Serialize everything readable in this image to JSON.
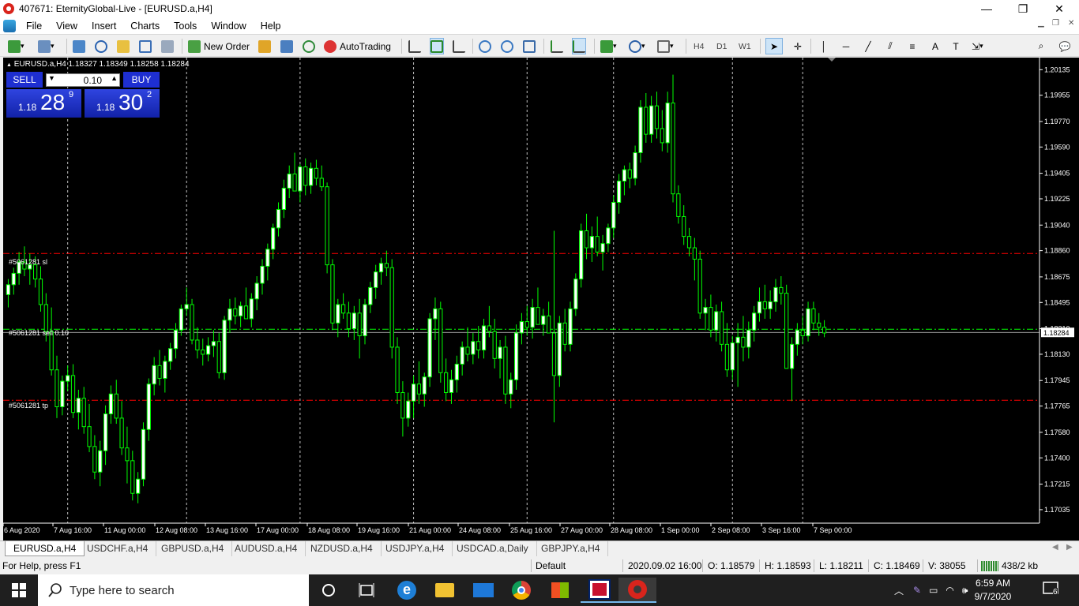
{
  "window": {
    "title": "407671: EternityGlobal-Live - [EURUSD.a,H4]",
    "minimize": "—",
    "restore": "❐",
    "close": "✕"
  },
  "menu": [
    "File",
    "View",
    "Insert",
    "Charts",
    "Tools",
    "Window",
    "Help"
  ],
  "toolbar": {
    "new_order": "New Order",
    "autotrading": "AutoTrading",
    "timeframes": [
      "H4",
      "D1",
      "W1"
    ],
    "text_tool": "A"
  },
  "chart": {
    "header": "EURUSD.a,H4  1.18327 1.18349 1.18258 1.18284",
    "one_click": {
      "sell_label": "SELL",
      "buy_label": "BUY",
      "lot": "0.10",
      "sell_big": "28",
      "sell_prefix": "1.18",
      "sell_sup": "9",
      "buy_big": "30",
      "buy_prefix": "1.18",
      "buy_sup": "2"
    },
    "order_labels": {
      "sl": "#5061281 sl",
      "entry": "#5061281 sell 0.10",
      "tp": "#5061281 tp"
    },
    "levels": {
      "sl": 1.1884,
      "entry": 1.18306,
      "tp": 1.17806,
      "bid": 1.18284
    },
    "current_price_label": "1.18284",
    "price_labels": [
      "1.20135",
      "1.19955",
      "1.19770",
      "1.19590",
      "1.19405",
      "1.19225",
      "1.19040",
      "1.18860",
      "1.18675",
      "1.18495",
      "1.18310",
      "1.18130",
      "1.17945",
      "1.17765",
      "1.17580",
      "1.17400",
      "1.17215",
      "1.17035"
    ],
    "time_labels": [
      "6 Aug 2020",
      "7 Aug 16:00",
      "11 Aug 00:00",
      "12 Aug 08:00",
      "13 Aug 16:00",
      "17 Aug 00:00",
      "18 Aug 08:00",
      "19 Aug 16:00",
      "21 Aug 00:00",
      "24 Aug 08:00",
      "25 Aug 16:00",
      "27 Aug 00:00",
      "28 Aug 08:00",
      "1 Sep 00:00",
      "2 Sep 08:00",
      "3 Sep 16:00",
      "7 Sep 00:00"
    ],
    "colors": {
      "background": "#000000",
      "candle": "#00ff00",
      "bull_fill": "#ffffff",
      "bear_fill": "#000000",
      "sl_tp_line": "#ff0000",
      "entry_line": "#00ff00",
      "separators": "#c0c0c0",
      "text": "#ffffff"
    }
  },
  "chart_data": {
    "type": "candlestick",
    "symbol": "EURUSD.a",
    "timeframe": "H4",
    "ylim": [
      1.1694,
      1.2022
    ],
    "period_separators": [
      "7 Aug 2020",
      "12 Aug 2020",
      "17 Aug 2020",
      "20 Aug 2020",
      "25 Aug 2020",
      "28 Aug 2020",
      "2 Sep 2020",
      "7 Sep 2020"
    ],
    "current": {
      "open": 1.18327,
      "high": 1.18349,
      "low": 1.18258,
      "close": 1.18284
    },
    "ohlc": [
      [
        1.1855,
        1.1866,
        1.1846,
        1.1862
      ],
      [
        1.1862,
        1.1874,
        1.1855,
        1.187
      ],
      [
        1.187,
        1.1885,
        1.1862,
        1.1878
      ],
      [
        1.1878,
        1.1889,
        1.1868,
        1.1873
      ],
      [
        1.1873,
        1.1884,
        1.1862,
        1.1876
      ],
      [
        1.1876,
        1.1882,
        1.186,
        1.1866
      ],
      [
        1.1866,
        1.1875,
        1.1843,
        1.1848
      ],
      [
        1.1848,
        1.1856,
        1.1822,
        1.1829
      ],
      [
        1.1829,
        1.1846,
        1.1798,
        1.1802
      ],
      [
        1.1802,
        1.1812,
        1.1768,
        1.1776
      ],
      [
        1.1776,
        1.1798,
        1.177,
        1.1794
      ],
      [
        1.1794,
        1.1805,
        1.1787,
        1.1798
      ],
      [
        1.1798,
        1.1806,
        1.1768,
        1.1772
      ],
      [
        1.1772,
        1.1788,
        1.176,
        1.1782
      ],
      [
        1.1782,
        1.179,
        1.1757,
        1.1762
      ],
      [
        1.1762,
        1.1778,
        1.1744,
        1.1748
      ],
      [
        1.1748,
        1.1756,
        1.1725,
        1.173
      ],
      [
        1.173,
        1.1752,
        1.172,
        1.1745
      ],
      [
        1.1745,
        1.1777,
        1.1735,
        1.1771
      ],
      [
        1.1771,
        1.1791,
        1.1764,
        1.1785
      ],
      [
        1.1785,
        1.1795,
        1.1764,
        1.1768
      ],
      [
        1.1768,
        1.178,
        1.1742,
        1.1747
      ],
      [
        1.1747,
        1.1762,
        1.1722,
        1.1738
      ],
      [
        1.1738,
        1.1745,
        1.171,
        1.1715
      ],
      [
        1.1715,
        1.173,
        1.1708,
        1.1725
      ],
      [
        1.1725,
        1.1765,
        1.172,
        1.176
      ],
      [
        1.176,
        1.1796,
        1.1752,
        1.1792
      ],
      [
        1.1792,
        1.1811,
        1.1784,
        1.1805
      ],
      [
        1.1805,
        1.1816,
        1.1791,
        1.1796
      ],
      [
        1.1796,
        1.1812,
        1.1786,
        1.1808
      ],
      [
        1.1808,
        1.1821,
        1.1802,
        1.1817
      ],
      [
        1.1817,
        1.1835,
        1.181,
        1.183
      ],
      [
        1.183,
        1.1848,
        1.1826,
        1.1845
      ],
      [
        1.1845,
        1.186,
        1.184,
        1.1848
      ],
      [
        1.1848,
        1.1852,
        1.182,
        1.1823
      ],
      [
        1.1823,
        1.1832,
        1.181,
        1.1816
      ],
      [
        1.1816,
        1.1824,
        1.1805,
        1.1813
      ],
      [
        1.1813,
        1.1825,
        1.1808,
        1.1819
      ],
      [
        1.1819,
        1.183,
        1.1811,
        1.1822
      ],
      [
        1.1822,
        1.1828,
        1.1796,
        1.18
      ],
      [
        1.18,
        1.184,
        1.1795,
        1.1837
      ],
      [
        1.1837,
        1.1852,
        1.1828,
        1.1845
      ],
      [
        1.1845,
        1.1853,
        1.1834,
        1.184
      ],
      [
        1.184,
        1.185,
        1.1832,
        1.1847
      ],
      [
        1.1847,
        1.186,
        1.184,
        1.1838
      ],
      [
        1.1838,
        1.1856,
        1.1832,
        1.1852
      ],
      [
        1.1852,
        1.1868,
        1.1844,
        1.1863
      ],
      [
        1.1863,
        1.188,
        1.1855,
        1.1875
      ],
      [
        1.1875,
        1.1891,
        1.1865,
        1.1887
      ],
      [
        1.1887,
        1.1905,
        1.188,
        1.1902
      ],
      [
        1.1902,
        1.192,
        1.1896,
        1.1915
      ],
      [
        1.1915,
        1.1936,
        1.1909,
        1.193
      ],
      [
        1.193,
        1.1946,
        1.1923,
        1.194
      ],
      [
        1.194,
        1.1955,
        1.1932,
        1.1928
      ],
      [
        1.1928,
        1.1947,
        1.192,
        1.1945
      ],
      [
        1.1945,
        1.1951,
        1.1925,
        1.1932
      ],
      [
        1.1932,
        1.1948,
        1.1926,
        1.1944
      ],
      [
        1.1944,
        1.195,
        1.1932,
        1.1937
      ],
      [
        1.1937,
        1.1946,
        1.1928,
        1.1931
      ],
      [
        1.1931,
        1.1934,
        1.187,
        1.1876
      ],
      [
        1.1876,
        1.188,
        1.183,
        1.1835
      ],
      [
        1.1835,
        1.1852,
        1.1825,
        1.1848
      ],
      [
        1.1848,
        1.1856,
        1.1838,
        1.1842
      ],
      [
        1.1842,
        1.185,
        1.1825,
        1.1831
      ],
      [
        1.1831,
        1.1847,
        1.1823,
        1.1842
      ],
      [
        1.1842,
        1.1852,
        1.181,
        1.1826
      ],
      [
        1.1826,
        1.1852,
        1.182,
        1.1848
      ],
      [
        1.1848,
        1.1864,
        1.1842,
        1.186
      ],
      [
        1.186,
        1.1876,
        1.1852,
        1.1871
      ],
      [
        1.1871,
        1.1881,
        1.1862,
        1.1877
      ],
      [
        1.1877,
        1.1886,
        1.1868,
        1.1874
      ],
      [
        1.1874,
        1.188,
        1.181,
        1.1818
      ],
      [
        1.1818,
        1.1825,
        1.1778,
        1.1786
      ],
      [
        1.1786,
        1.1794,
        1.1755,
        1.1768
      ],
      [
        1.1768,
        1.1786,
        1.1762,
        1.178
      ],
      [
        1.178,
        1.1798,
        1.1768,
        1.1792
      ],
      [
        1.1792,
        1.1808,
        1.1778,
        1.1785
      ],
      [
        1.1785,
        1.18,
        1.1776,
        1.1797
      ],
      [
        1.1797,
        1.1842,
        1.179,
        1.1838
      ],
      [
        1.1838,
        1.1853,
        1.1823,
        1.1845
      ],
      [
        1.1845,
        1.185,
        1.1793,
        1.18
      ],
      [
        1.18,
        1.181,
        1.178,
        1.1786
      ],
      [
        1.1786,
        1.1802,
        1.1778,
        1.1795
      ],
      [
        1.1795,
        1.1812,
        1.1786,
        1.1806
      ],
      [
        1.1806,
        1.1822,
        1.1798,
        1.1818
      ],
      [
        1.1818,
        1.1832,
        1.1808,
        1.1813
      ],
      [
        1.1813,
        1.1828,
        1.1806,
        1.1822
      ],
      [
        1.1822,
        1.1833,
        1.181,
        1.1816
      ],
      [
        1.1816,
        1.1838,
        1.181,
        1.1833
      ],
      [
        1.1833,
        1.1847,
        1.1825,
        1.1829
      ],
      [
        1.1829,
        1.1838,
        1.1803,
        1.181
      ],
      [
        1.181,
        1.1823,
        1.1796,
        1.1818
      ],
      [
        1.1818,
        1.1826,
        1.1778,
        1.1785
      ],
      [
        1.1785,
        1.18,
        1.1775,
        1.1795
      ],
      [
        1.1795,
        1.1834,
        1.1788,
        1.1828
      ],
      [
        1.1828,
        1.1842,
        1.182,
        1.1836
      ],
      [
        1.1836,
        1.1847,
        1.1826,
        1.1832
      ],
      [
        1.1832,
        1.1852,
        1.1824,
        1.1846
      ],
      [
        1.1846,
        1.186,
        1.1838,
        1.1834
      ],
      [
        1.1834,
        1.1845,
        1.1826,
        1.184
      ],
      [
        1.184,
        1.185,
        1.183,
        1.1828
      ],
      [
        1.1828,
        1.19,
        1.1765,
        1.1798
      ],
      [
        1.1798,
        1.184,
        1.179,
        1.1835
      ],
      [
        1.1835,
        1.1845,
        1.1815,
        1.182
      ],
      [
        1.182,
        1.185,
        1.1815,
        1.1845
      ],
      [
        1.1845,
        1.187,
        1.184,
        1.1866
      ],
      [
        1.1866,
        1.1905,
        1.186,
        1.19
      ],
      [
        1.19,
        1.1912,
        1.188,
        1.1888
      ],
      [
        1.1888,
        1.1903,
        1.1878,
        1.1896
      ],
      [
        1.1896,
        1.191,
        1.1882,
        1.1885
      ],
      [
        1.1885,
        1.1897,
        1.1872,
        1.1891
      ],
      [
        1.1891,
        1.1905,
        1.1885,
        1.1902
      ],
      [
        1.1902,
        1.1925,
        1.1895,
        1.192
      ],
      [
        1.192,
        1.194,
        1.1912,
        1.1935
      ],
      [
        1.1935,
        1.1946,
        1.1925,
        1.1943
      ],
      [
        1.1943,
        1.1948,
        1.193,
        1.1937
      ],
      [
        1.1937,
        1.196,
        1.1932,
        1.1955
      ],
      [
        1.1955,
        1.1992,
        1.1948,
        1.1987
      ],
      [
        1.1987,
        1.1997,
        1.1962,
        1.1968
      ],
      [
        1.1968,
        1.1995,
        1.1962,
        1.1988
      ],
      [
        1.1988,
        1.1998,
        1.1965,
        1.1972
      ],
      [
        1.1972,
        1.1985,
        1.1956,
        1.1962
      ],
      [
        1.1962,
        1.1998,
        1.1955,
        1.199
      ],
      [
        1.199,
        1.201,
        1.192,
        1.1926
      ],
      [
        1.1926,
        1.1932,
        1.1905,
        1.191
      ],
      [
        1.191,
        1.1918,
        1.189,
        1.1896
      ],
      [
        1.1896,
        1.1902,
        1.1882,
        1.1888
      ],
      [
        1.1888,
        1.1895,
        1.1865,
        1.188
      ],
      [
        1.188,
        1.1886,
        1.1838,
        1.1842
      ],
      [
        1.1842,
        1.1852,
        1.183,
        1.1846
      ],
      [
        1.1846,
        1.1855,
        1.1825,
        1.183
      ],
      [
        1.183,
        1.1848,
        1.1822,
        1.1843
      ],
      [
        1.1843,
        1.185,
        1.1815,
        1.182
      ],
      [
        1.182,
        1.1835,
        1.1797,
        1.1802
      ],
      [
        1.1802,
        1.1826,
        1.1795,
        1.1821
      ],
      [
        1.1821,
        1.1835,
        1.179,
        1.1825
      ],
      [
        1.1825,
        1.184,
        1.1808,
        1.1818
      ],
      [
        1.1818,
        1.1836,
        1.181,
        1.183
      ],
      [
        1.183,
        1.1847,
        1.1822,
        1.1842
      ],
      [
        1.1842,
        1.186,
        1.1836,
        1.185
      ],
      [
        1.185,
        1.1862,
        1.1838,
        1.1845
      ],
      [
        1.1845,
        1.1858,
        1.1838,
        1.185
      ],
      [
        1.185,
        1.1866,
        1.1843,
        1.186
      ],
      [
        1.186,
        1.1868,
        1.1848,
        1.1856
      ],
      [
        1.1856,
        1.1862,
        1.181,
        1.1803
      ],
      [
        1.1803,
        1.1825,
        1.178,
        1.182
      ],
      [
        1.182,
        1.1835,
        1.1812,
        1.183
      ],
      [
        1.183,
        1.184,
        1.182,
        1.1826
      ],
      [
        1.1826,
        1.185,
        1.1822,
        1.1845
      ],
      [
        1.1845,
        1.185,
        1.183,
        1.1835
      ],
      [
        1.1835,
        1.1842,
        1.1826,
        1.1832
      ],
      [
        1.1832,
        1.1837,
        1.1825,
        1.1828
      ]
    ]
  },
  "tabs": [
    "EURUSD.a,H4",
    "USDCHF.a,H4",
    "GBPUSD.a,H4",
    "AUDUSD.a,H4",
    "NZDUSD.a,H4",
    "USDJPY.a,H4",
    "USDCAD.a,Daily",
    "GBPJPY.a,H4"
  ],
  "status": {
    "help": "For Help, press F1",
    "profile": "Default",
    "datetime": "2020.09.02 16:00",
    "open": "O: 1.18579",
    "high": "H: 1.18593",
    "low": "L: 1.18211",
    "close": "C: 1.18469",
    "volume": "V: 38055",
    "traffic": "438/2 kb"
  },
  "taskbar": {
    "search_placeholder": "Type here to search",
    "time": "6:59 AM",
    "date": "9/7/2020",
    "notification_count": "6"
  }
}
